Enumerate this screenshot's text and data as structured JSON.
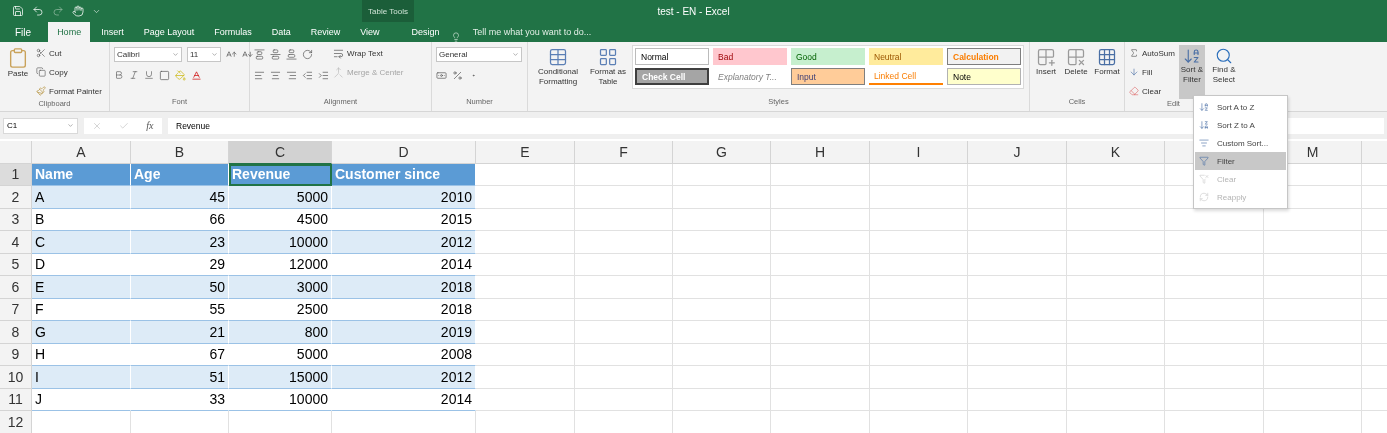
{
  "window": {
    "title": "test - EN - Excel",
    "context_label": "Table Tools"
  },
  "tabs": [
    {
      "label": "File",
      "selected": false,
      "kind": "file"
    },
    {
      "label": "Home",
      "selected": true,
      "kind": "main"
    },
    {
      "label": "Insert",
      "selected": false,
      "kind": "main"
    },
    {
      "label": "Page Layout",
      "selected": false,
      "kind": "main"
    },
    {
      "label": "Formulas",
      "selected": false,
      "kind": "main"
    },
    {
      "label": "Data",
      "selected": false,
      "kind": "main"
    },
    {
      "label": "Review",
      "selected": false,
      "kind": "main"
    },
    {
      "label": "View",
      "selected": false,
      "kind": "main"
    },
    {
      "label": "Design",
      "selected": false,
      "kind": "context"
    }
  ],
  "tell_me": {
    "placeholder": "Tell me what you want to do..."
  },
  "ribbon": {
    "clipboard": {
      "label": "Clipboard",
      "paste": "Paste",
      "cut": "Cut",
      "copy": "Copy",
      "format_painter": "Format Painter"
    },
    "font": {
      "label": "Font",
      "font_name": "Calibri",
      "font_size": "11"
    },
    "alignment": {
      "label": "Alignment",
      "wrap_text": "Wrap Text",
      "merge": {
        "label": "Merge & Center",
        "disabled": true
      }
    },
    "number": {
      "label": "Number",
      "format": "General"
    },
    "styles": {
      "label": "Styles",
      "conditional": "Conditional Formatting",
      "format_table": "Format as Table",
      "cells": [
        {
          "label": "Normal",
          "kind": "normal"
        },
        {
          "label": "Bad",
          "kind": "bad"
        },
        {
          "label": "Good",
          "kind": "good"
        },
        {
          "label": "Neutral",
          "kind": "neutral"
        },
        {
          "label": "Calculation",
          "kind": "calculation"
        },
        {
          "label": "Check Cell",
          "kind": "check"
        },
        {
          "label": "Explanatory T...",
          "kind": "explanatory"
        },
        {
          "label": "Input",
          "kind": "input"
        },
        {
          "label": "Linked Cell",
          "kind": "linked"
        },
        {
          "label": "Note",
          "kind": "note"
        }
      ]
    },
    "cells": {
      "label": "Cells",
      "insert": "Insert",
      "delete": "Delete",
      "format": "Format"
    },
    "editing": {
      "label": "Edit",
      "autosum": "AutoSum",
      "fill": "Fill",
      "clear": "Clear",
      "sort_filter": {
        "label": "Sort & Filter",
        "pressed": true
      },
      "find_select": "Find & Select"
    }
  },
  "formula_bar": {
    "name_box": "C1",
    "function_label": "fx",
    "formula": "Revenue"
  },
  "table": {
    "columns": [
      {
        "label": "A",
        "selected": false
      },
      {
        "label": "B",
        "selected": false
      },
      {
        "label": "C",
        "selected": true
      },
      {
        "label": "D",
        "selected": false
      },
      {
        "label": "E",
        "selected": false
      },
      {
        "label": "F",
        "selected": false
      },
      {
        "label": "G",
        "selected": false
      },
      {
        "label": "H",
        "selected": false
      },
      {
        "label": "I",
        "selected": false
      },
      {
        "label": "J",
        "selected": false
      },
      {
        "label": "K",
        "selected": false
      },
      {
        "selected": false
      },
      {
        "label": "M",
        "selected": false
      }
    ],
    "rows": [
      {
        "number": "1",
        "kind": "header",
        "selected": true,
        "cells": [
          "Name",
          "Age",
          "Revenue",
          "Customer since"
        ]
      },
      {
        "number": "2",
        "kind": "data",
        "selected": false,
        "cells": [
          "A",
          "45",
          "5000",
          "2010"
        ]
      },
      {
        "number": "3",
        "kind": "data",
        "selected": false,
        "cells": [
          "B",
          "66",
          "4500",
          "2015"
        ]
      },
      {
        "number": "4",
        "kind": "data",
        "selected": false,
        "cells": [
          "C",
          "23",
          "10000",
          "2012"
        ]
      },
      {
        "number": "5",
        "kind": "data",
        "selected": false,
        "cells": [
          "D",
          "29",
          "12000",
          "2014"
        ]
      },
      {
        "number": "6",
        "kind": "data",
        "selected": false,
        "cells": [
          "E",
          "50",
          "3000",
          "2018"
        ]
      },
      {
        "number": "7",
        "kind": "data",
        "selected": false,
        "cells": [
          "F",
          "55",
          "2500",
          "2018"
        ]
      },
      {
        "number": "8",
        "kind": "data",
        "selected": false,
        "cells": [
          "G",
          "21",
          "800",
          "2019"
        ]
      },
      {
        "number": "9",
        "kind": "data",
        "selected": false,
        "cells": [
          "H",
          "67",
          "5000",
          "2008"
        ]
      },
      {
        "number": "10",
        "kind": "data",
        "selected": false,
        "cells": [
          "I",
          "51",
          "15000",
          "2012"
        ]
      },
      {
        "number": "11",
        "kind": "data",
        "selected": false,
        "cells": [
          "J",
          "33",
          "10000",
          "2014"
        ]
      },
      {
        "number": "12",
        "kind": "empty",
        "selected": false,
        "cells": []
      }
    ]
  },
  "sort_menu": {
    "items": [
      {
        "label": "Sort A to Z",
        "kind": "az",
        "selected": false,
        "disabled": false
      },
      {
        "label": "Sort Z to A",
        "kind": "za",
        "selected": false,
        "disabled": false
      },
      {
        "label": "Custom Sort...",
        "kind": "custom",
        "selected": false,
        "disabled": false
      },
      {
        "label": "Filter",
        "kind": "filter",
        "selected": true,
        "disabled": false
      },
      {
        "label": "Clear",
        "kind": "clear",
        "selected": false,
        "disabled": true
      },
      {
        "label": "Reapply",
        "kind": "reapply",
        "selected": false,
        "disabled": true
      }
    ]
  }
}
